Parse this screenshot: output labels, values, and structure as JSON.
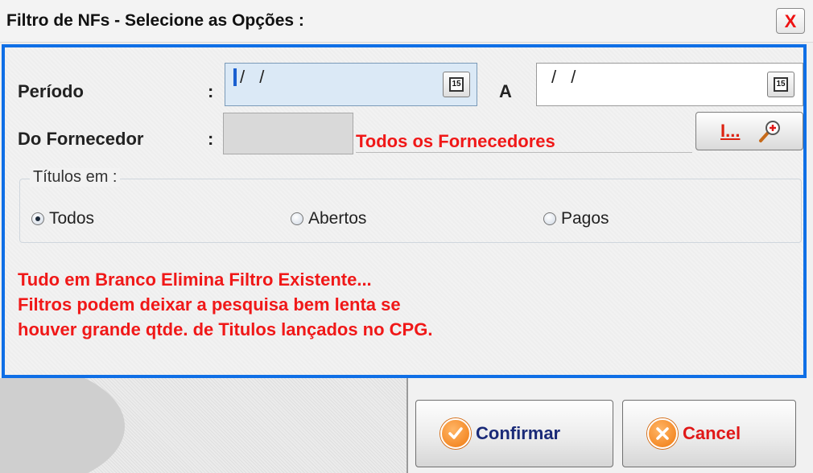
{
  "window": {
    "title": "Filtro de NFs - Selecione as Opções :",
    "close_label": "X"
  },
  "periodo": {
    "label": "Período",
    "colon": ":",
    "from_value": "/ /",
    "separator": "A",
    "to_value": "/ /",
    "calendar_text": "15"
  },
  "fornecedor": {
    "label": "Do Fornecedor",
    "colon": ":",
    "code_value": "",
    "name_value": "Todos os Fornecedores",
    "lookup_label": "I..."
  },
  "titulos": {
    "legend": "Títulos em :",
    "options": [
      {
        "label": "Todos",
        "checked": true
      },
      {
        "label": "Abertos",
        "checked": false
      },
      {
        "label": "Pagos",
        "checked": false
      }
    ]
  },
  "warnings": [
    "Tudo em Branco Elimina Filtro Existente...",
    "Filtros podem deixar a pesquisa bem lenta se",
    "houver grande qtde. de Titulos lançados no CPG."
  ],
  "actions": {
    "confirm_label": "Confirmar",
    "cancel_label": "Cancel"
  },
  "colors": {
    "accent_border": "#0f6fe6",
    "warning_text": "#f01818",
    "confirm_text": "#1a2a78",
    "cancel_text": "#e01818",
    "action_icon": "#f07a10"
  },
  "icons": [
    "close-icon",
    "calendar-icon",
    "magnifier-plus-icon",
    "check-circle-icon",
    "x-circle-icon"
  ]
}
